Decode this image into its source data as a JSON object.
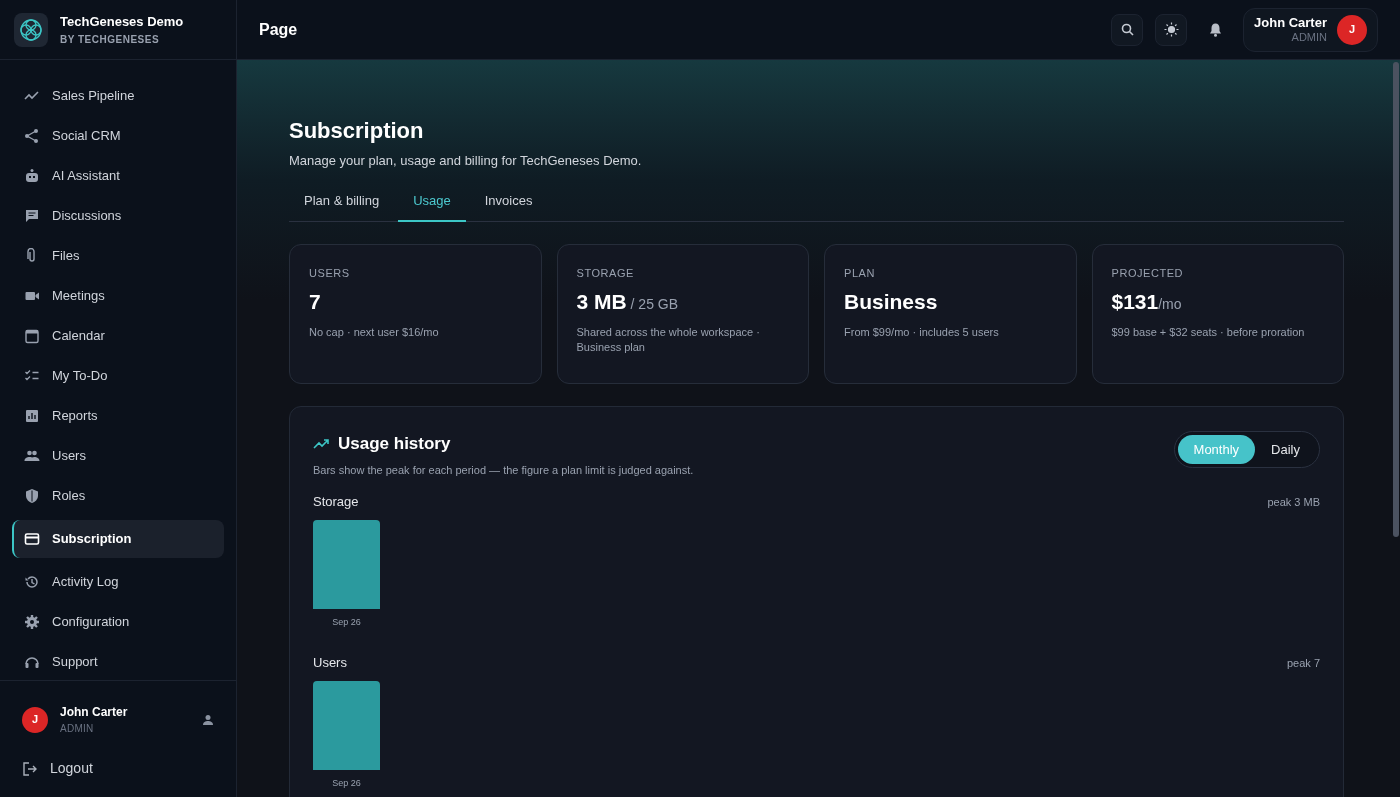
{
  "brand": {
    "name": "TechGeneses Demo",
    "tagline": "BY TECHGENESES"
  },
  "sidebar": {
    "items": [
      {
        "label": "Sales Pipeline",
        "selected": false
      },
      {
        "label": "Social CRM",
        "selected": false
      },
      {
        "label": "AI Assistant",
        "selected": false
      },
      {
        "label": "Discussions",
        "selected": false
      },
      {
        "label": "Files",
        "selected": false
      },
      {
        "label": "Meetings",
        "selected": false
      },
      {
        "label": "Calendar",
        "selected": false
      },
      {
        "label": "My To-Do",
        "selected": false
      },
      {
        "label": "Reports",
        "selected": false
      },
      {
        "label": "Users",
        "selected": false
      },
      {
        "label": "Roles",
        "selected": false
      },
      {
        "label": "Subscription",
        "selected": true
      },
      {
        "label": "Activity Log",
        "selected": false
      },
      {
        "label": "Configuration",
        "selected": false
      },
      {
        "label": "Support",
        "selected": false
      }
    ],
    "user": {
      "initial": "J",
      "name": "John Carter",
      "role": "ADMIN"
    },
    "logout": "Logout"
  },
  "header": {
    "title": "Page",
    "user": {
      "name": "John Carter",
      "role": "ADMIN",
      "initial": "J"
    }
  },
  "page": {
    "title": "Subscription",
    "subtitle": "Manage your plan, usage and billing for TechGeneses Demo."
  },
  "tabs": [
    {
      "label": "Plan & billing",
      "selected": false
    },
    {
      "label": "Usage",
      "selected": true
    },
    {
      "label": "Invoices",
      "selected": false
    }
  ],
  "stats": [
    {
      "label": "USERS",
      "value": "7",
      "note": "No cap · next user $16/mo"
    },
    {
      "label": "STORAGE",
      "value": "3 MB",
      "suffix": " / 25 GB",
      "note": "Shared across the whole workspace · Business plan"
    },
    {
      "label": "PLAN",
      "value": "Business",
      "note": "From $99/mo · includes 5 users"
    },
    {
      "label": "PROJECTED",
      "value": "$131",
      "suffix": "/mo",
      "note": "$99 base + $32 seats · before proration"
    }
  ],
  "usage": {
    "title": "Usage history",
    "subtitle": "Bars show the peak for each period — the figure a plan limit is judged against.",
    "toggle": [
      {
        "label": "Monthly",
        "selected": true
      },
      {
        "label": "Daily",
        "selected": false
      }
    ],
    "charts": [
      {
        "name": "Storage",
        "peak": "peak 3 MB",
        "bars": [
          "Sep 26"
        ]
      },
      {
        "name": "Users",
        "peak": "peak 7",
        "bars": [
          "Sep 26"
        ]
      }
    ]
  }
}
